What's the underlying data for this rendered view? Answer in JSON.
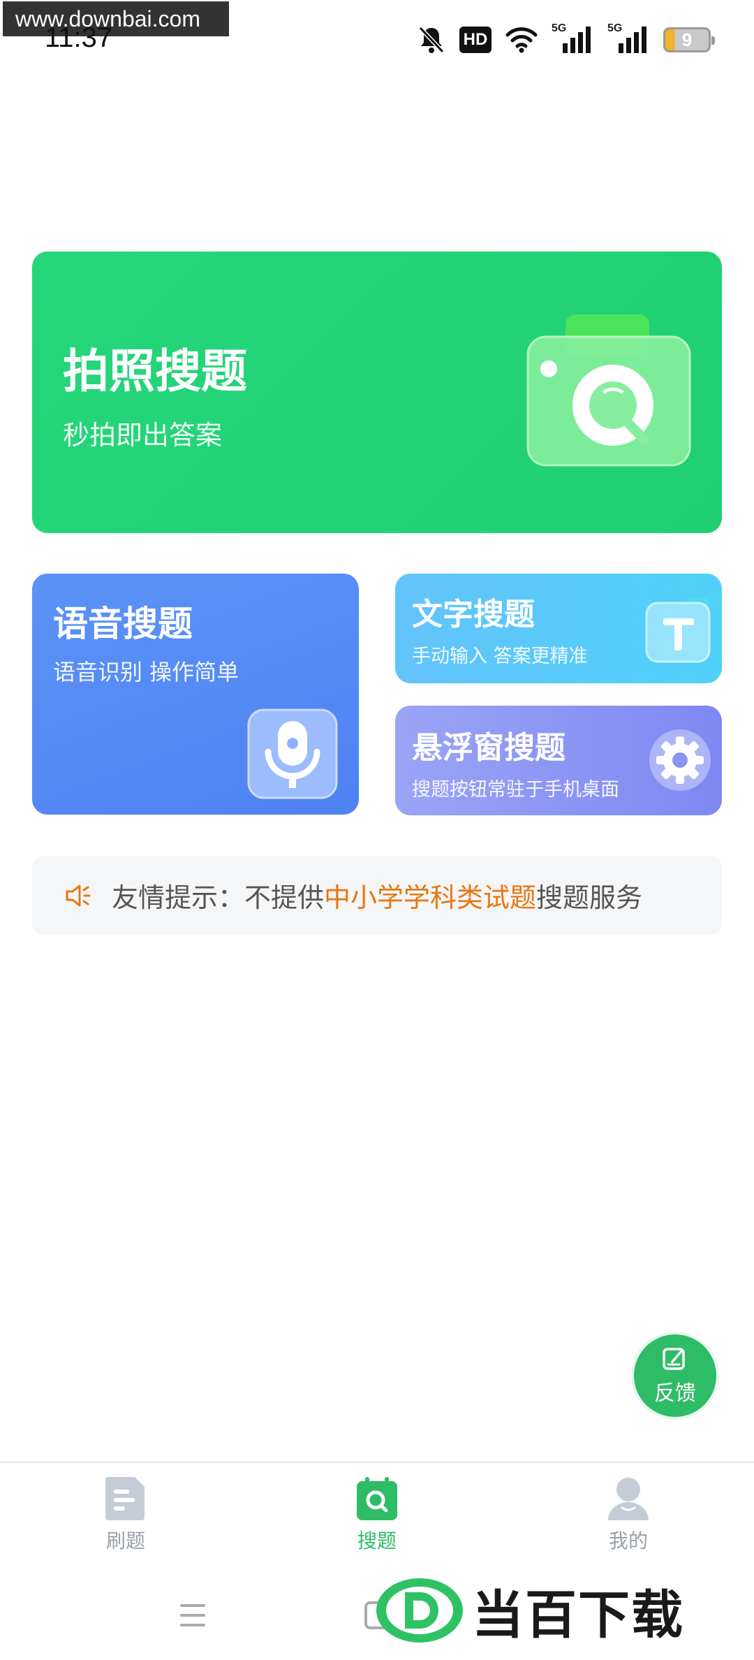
{
  "status_bar": {
    "watermark": "www.downbai.com",
    "time": "11:37",
    "hd_label": "HD",
    "net_1": "5G",
    "net_2": "5G",
    "battery": "9"
  },
  "cards": {
    "photo": {
      "title": "拍照搜题",
      "subtitle": "秒拍即出答案"
    },
    "voice": {
      "title": "语音搜题",
      "subtitle": "语音识别 操作简单"
    },
    "text": {
      "title": "文字搜题",
      "subtitle": "手动输入 答案更精准"
    },
    "float": {
      "title": "悬浮窗搜题",
      "subtitle": "搜题按钮常驻于手机桌面"
    }
  },
  "notice": {
    "prefix": "友情提示：不提供",
    "highlight": "中小学学科类试题",
    "suffix": "搜题服务"
  },
  "feedback": {
    "label": "反馈"
  },
  "bottom_nav": {
    "items": [
      {
        "label": "刷题"
      },
      {
        "label": "搜题"
      },
      {
        "label": "我的"
      }
    ]
  },
  "brand": {
    "name": "当百下载"
  },
  "colors": {
    "primary_green": "#2ebc66",
    "photo_card": "#22d274",
    "voice_card": "#5389f4",
    "text_card": "#58cafa",
    "float_card": "#8c96f4",
    "notice_highlight": "#e8770f"
  }
}
